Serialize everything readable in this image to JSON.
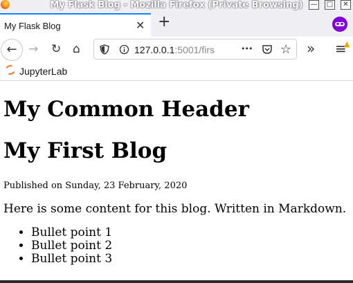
{
  "window": {
    "title": "My Flask Blog - Mozilla Firefox (Private Browsing)",
    "minimize_glyph": "—",
    "maximize_glyph": "□",
    "close_glyph": "✕"
  },
  "tab": {
    "label": "My Flask Blog",
    "close_glyph": "✕"
  },
  "new_tab_glyph": "+",
  "nav": {
    "back_glyph": "←",
    "forward_glyph": "→",
    "reload_glyph": "↻",
    "home_glyph": "⌂",
    "more_glyph": "•••",
    "overflow_glyph": "»",
    "menu_glyph": "≡",
    "warning_glyph": "▲",
    "star_glyph": "☆",
    "url_host": "127.0.0.1",
    "url_rest": ":5001/firs"
  },
  "bookmarks": [
    {
      "label": "JupyterLab",
      "icon": "jupyter-icon"
    }
  ],
  "page": {
    "header": "My Common Header",
    "title": "My First Blog",
    "published": "Published on Sunday, 23 February, 2020",
    "body": "Here is some content for this blog. Written in Markdown.",
    "bullets": [
      "Bullet point 1",
      "Bullet point 2",
      "Bullet point 3"
    ]
  },
  "colors": {
    "accent": "#0a84ff",
    "private": "#8000d7",
    "jupyter": "#f37726"
  }
}
